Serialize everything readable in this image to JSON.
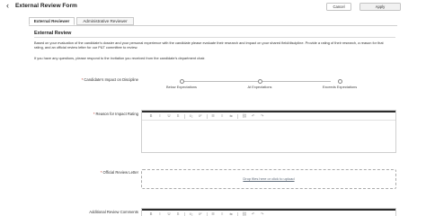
{
  "header": {
    "back_glyph": "‹",
    "title": "External Review Form",
    "cancel_label": "Cancel",
    "apply_label": "Apply"
  },
  "tabs": [
    {
      "label": "External Reviewer",
      "active": true
    },
    {
      "label": "Administrative Reviewer",
      "active": false
    }
  ],
  "section": {
    "title": "External Review",
    "description": "Based on your evaluation of the candidate’s dossier and your personal experience with the candidate please evaluate their research and impact on your shared field/discipline. Provide a rating of their research, a reason for that rating, and an official review letter for our P&T committee to review.",
    "note": "If you have any questions, please respond to the invitation you received from the candidate’s department chair."
  },
  "impact_field": {
    "label": "Candidate's Impact on Discipline",
    "required": "*",
    "options": [
      "Below Expectations",
      "At Expectations",
      "Exceeds Expectations"
    ]
  },
  "reason_field": {
    "label": "Reason for Impact Rating",
    "required": "*"
  },
  "letter_field": {
    "label": "Official Review Letter",
    "required": "*",
    "drop_text": "Drop files here or click to upload"
  },
  "comments_field": {
    "label": "Additional Review Comments"
  },
  "toolbar": {
    "icons": [
      "bold-icon",
      "italic-icon",
      "underline-icon",
      "strikethrough-icon",
      "subscript-icon",
      "superscript-icon",
      "bullet-list-icon",
      "numbered-list-icon",
      "align-icon",
      "link-icon",
      "undo-icon",
      "redo-icon"
    ],
    "glyphs": [
      "B",
      "I",
      "U",
      "S",
      "x₂",
      "x²",
      "☰",
      "≡",
      "⇆",
      "⛓",
      "↶",
      "↷"
    ]
  },
  "colors": {
    "required": "#c0392b",
    "editor_top": "#2b2b2b",
    "link": "#5f6b7a"
  }
}
